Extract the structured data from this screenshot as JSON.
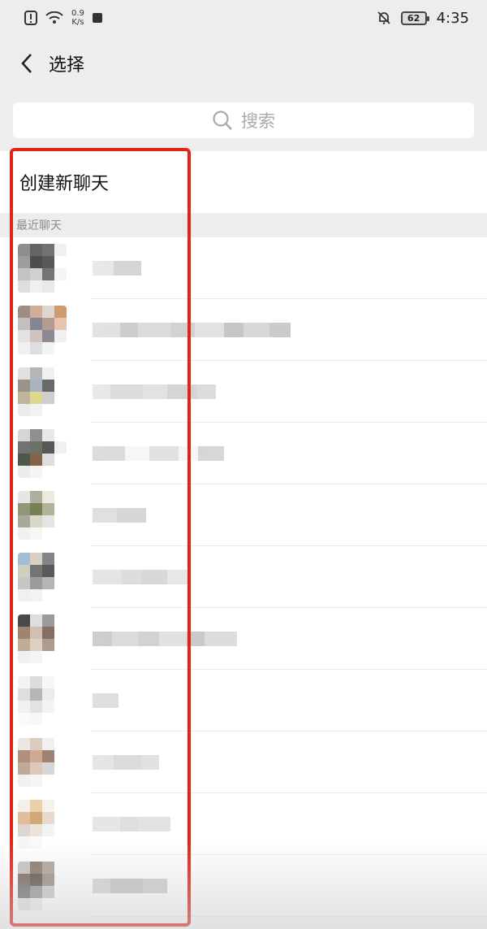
{
  "status_bar": {
    "speed_value": "0.9",
    "speed_unit": "K/s",
    "battery": "62",
    "time": "4:35",
    "icons": [
      "alert-icon",
      "wifi-icon",
      "app-notification-icon",
      "bell-off-icon",
      "battery-icon"
    ]
  },
  "nav": {
    "title": "选择",
    "back_icon": "chevron-left-icon"
  },
  "search": {
    "placeholder": "搜索",
    "icon": "search-icon"
  },
  "create_chat_label": "创建新聊天",
  "recent_section_label": "最近聊天",
  "colors": {
    "highlight_border": "#e2231a",
    "page_background": "#ededed",
    "list_background": "#ffffff"
  },
  "recent_chats": [
    {
      "avatar": [
        "#7b7b7b",
        "#4a4a4a",
        "#5a5a5a",
        "#eeeeee",
        "#8d8d8d",
        "#2e2e2e",
        "#3b3b3b",
        "#ffffff",
        "#b9b9b9",
        "#c8c8c8",
        "#5c5c5c",
        "#f4f4f4",
        "#d8d8d8",
        "#eeeeee",
        "#e6e6e6",
        "#ffffff"
      ],
      "name_blocks": [
        "#e0e0e0",
        "#c8c8c8"
      ]
    },
    {
      "avatar": [
        "#8e7a6f",
        "#c9a183",
        "#d7d0c8",
        "#c48a57",
        "#b9b5b4",
        "#6e7082",
        "#a88d7d",
        "#e5b9a0",
        "#dddddd",
        "#c6b9b2",
        "#7d7482",
        "#eeeeee",
        "#eeeeee",
        "#d9d9d9",
        "#f1f1f1",
        "#ffffff"
      ],
      "name_blocks": [
        "#d8d8d8",
        "#bdbdbd",
        "#cfcfcf",
        "#c4c4c4",
        "#d9d9d9",
        "#b3b3b3",
        "#cccccc",
        "#bababa"
      ]
    },
    {
      "avatar": [
        "#dcdcdc",
        "#a9a9a9",
        "#eeeeee",
        "#ffffff",
        "#8a7f76",
        "#9aa8b8",
        "#4f4f4f",
        "#ffffff",
        "#b8a889",
        "#d8d27a",
        "#c6c6c6",
        "#ffffff",
        "#e8e8e8",
        "#f0f0f0",
        "#ffffff",
        "#ffffff"
      ],
      "name_blocks": [
        "#e0e0e0",
        "#d2d2d2",
        "#d9d9d9",
        "#c7c7c7",
        "#d1d1d1"
      ]
    },
    {
      "avatar": [
        "#cfcfcf",
        "#7c7c7c",
        "#e4e4e4",
        "#ffffff",
        "#5a5a5a",
        "#4e5a4d",
        "#3b3b3b",
        "#eeeeee",
        "#2f3a2d",
        "#6e4a26",
        "#d9d9d9",
        "#ffffff",
        "#e9e9e9",
        "#f4f4f4",
        "#ffffff",
        "#ffffff"
      ],
      "name_blocks": [
        "#d0d0d0",
        "#f3f3f3",
        "#d7d7d7",
        "#f3f3f3",
        "#c9c9c9"
      ]
    },
    {
      "avatar": [
        "#e2e2e2",
        "#a2a08a",
        "#e9e6dc",
        "#ffffff",
        "#7d8460",
        "#5f6a3a",
        "#a3a985",
        "#ffffff",
        "#9a9a8a",
        "#d3d1bb",
        "#e0e0e0",
        "#ffffff",
        "#eeeeee",
        "#f5f5f5",
        "#ffffff",
        "#ffffff"
      ],
      "name_blocks": [
        "#d6d6d6",
        "#c9c9c9"
      ]
    },
    {
      "avatar": [
        "#8fb3cf",
        "#d3c8b8",
        "#6f6f6f",
        "#ffffff",
        "#c9c6b6",
        "#5c5c5c",
        "#3d3d3d",
        "#ffffff",
        "#bdbdbd",
        "#8a8a8a",
        "#a9a9a9",
        "#ffffff",
        "#eeeeee",
        "#f0f0f0",
        "#ffffff",
        "#ffffff"
      ],
      "name_blocks": [
        "#dcdcdc",
        "#d2d2d2",
        "#cccccc",
        "#e0e0e0"
      ]
    },
    {
      "avatar": [
        "#2a2a2a",
        "#d9d9d9",
        "#8a8a8a",
        "#ffffff",
        "#8f6f55",
        "#c7b6a6",
        "#6e5848",
        "#ffffff",
        "#b89d86",
        "#d7c9b8",
        "#a28b79",
        "#ffffff",
        "#eeeeee",
        "#f3f3f3",
        "#ffffff",
        "#ffffff"
      ],
      "name_blocks": [
        "#bdbdbd",
        "#cfcfcf",
        "#c3c3c3",
        "#d7d7d7",
        "#b8b8b8",
        "#d1d1d1"
      ]
    },
    {
      "avatar": [
        "#f2f2f2",
        "#d7d7d7",
        "#f6f6f6",
        "#ffffff",
        "#d9d9d9",
        "#a9a9a9",
        "#e8e8e8",
        "#ffffff",
        "#eeeeee",
        "#dddddd",
        "#f2f2f2",
        "#ffffff",
        "#fafafa",
        "#f6f6f6",
        "#ffffff",
        "#ffffff"
      ],
      "name_blocks": [
        "#d4d4d4"
      ]
    },
    {
      "avatar": [
        "#e8e2da",
        "#d6c3b4",
        "#eeeeee",
        "#ffffff",
        "#a57c64",
        "#c59c7f",
        "#8f6d5a",
        "#ffffff",
        "#b79b86",
        "#d8c0ad",
        "#cfcfcf",
        "#ffffff",
        "#eeeeee",
        "#f4f4f4",
        "#ffffff",
        "#ffffff"
      ],
      "name_blocks": [
        "#dddddd",
        "#cfcfcf",
        "#d8d8d8"
      ]
    },
    {
      "avatar": [
        "#f3eee6",
        "#e7c89a",
        "#f6efe7",
        "#ffffff",
        "#d9b38a",
        "#c99b5e",
        "#e3d3c2",
        "#ffffff",
        "#d8cfc6",
        "#e9dfd5",
        "#f1f1f1",
        "#ffffff",
        "#f5f5f5",
        "#f8f8f8",
        "#ffffff",
        "#ffffff"
      ],
      "name_blocks": [
        "#dedede",
        "#d3d3d3",
        "#d9d9d9"
      ]
    },
    {
      "avatar": [
        "#bcbcbc",
        "#7a6456",
        "#a5968a",
        "#ffffff",
        "#6a5446",
        "#4a3a31",
        "#8f7f73",
        "#ffffff",
        "#5e5e5e",
        "#8a8a8a",
        "#c2c2c2",
        "#ffffff",
        "#e0e0e0",
        "#ededed",
        "#ffffff",
        "#ffffff"
      ],
      "name_blocks": [
        "#c9c9c9",
        "#b5b5b5",
        "#c2c2c2"
      ]
    }
  ]
}
